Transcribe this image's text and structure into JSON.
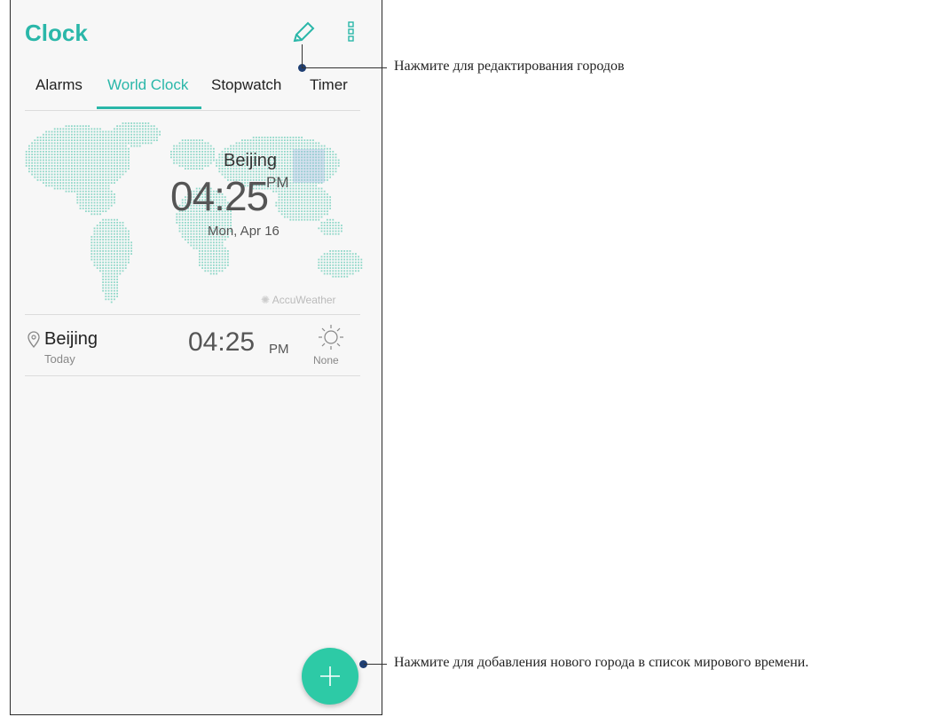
{
  "app": {
    "title": "Clock"
  },
  "tabs": [
    {
      "label": "Alarms"
    },
    {
      "label": "World Clock"
    },
    {
      "label": "Stopwatch"
    },
    {
      "label": "Timer"
    }
  ],
  "active_tab": "World Clock",
  "hero": {
    "city": "Beijing",
    "time": "04:25",
    "ampm": "PM",
    "date": "Mon, Apr 16"
  },
  "weather_provider": "AccuWeather",
  "cities": [
    {
      "name": "Beijing",
      "day": "Today",
      "time": "04:25",
      "ampm": "PM",
      "weather": "None"
    }
  ],
  "annotations": {
    "edit": "Нажмите для редактирования городов",
    "add": "Нажмите для добавления нового города в список мирового времени."
  },
  "colors": {
    "accent": "#2ab7a9",
    "fab": "#2dcaa6",
    "map_dots": "#8fd8c8",
    "callout_dot": "#1f3f73"
  },
  "icons": [
    "pencil-icon",
    "more-vert-icon",
    "location-pin-icon",
    "sun-icon",
    "plus-icon",
    "accuweather-logo-icon"
  ]
}
